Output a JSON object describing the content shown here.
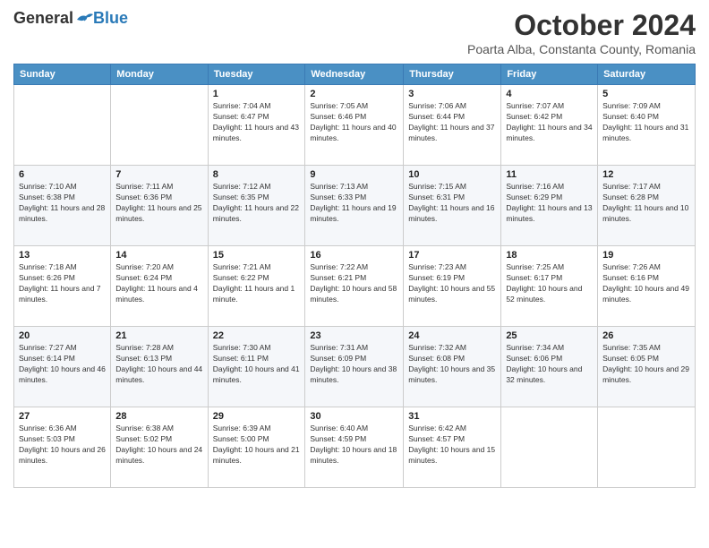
{
  "logo": {
    "general": "General",
    "blue": "Blue"
  },
  "header": {
    "month": "October 2024",
    "location": "Poarta Alba, Constanta County, Romania"
  },
  "weekdays": [
    "Sunday",
    "Monday",
    "Tuesday",
    "Wednesday",
    "Thursday",
    "Friday",
    "Saturday"
  ],
  "weeks": [
    [
      {
        "day": "",
        "sunrise": "",
        "sunset": "",
        "daylight": ""
      },
      {
        "day": "",
        "sunrise": "",
        "sunset": "",
        "daylight": ""
      },
      {
        "day": "1",
        "sunrise": "Sunrise: 7:04 AM",
        "sunset": "Sunset: 6:47 PM",
        "daylight": "Daylight: 11 hours and 43 minutes."
      },
      {
        "day": "2",
        "sunrise": "Sunrise: 7:05 AM",
        "sunset": "Sunset: 6:46 PM",
        "daylight": "Daylight: 11 hours and 40 minutes."
      },
      {
        "day": "3",
        "sunrise": "Sunrise: 7:06 AM",
        "sunset": "Sunset: 6:44 PM",
        "daylight": "Daylight: 11 hours and 37 minutes."
      },
      {
        "day": "4",
        "sunrise": "Sunrise: 7:07 AM",
        "sunset": "Sunset: 6:42 PM",
        "daylight": "Daylight: 11 hours and 34 minutes."
      },
      {
        "day": "5",
        "sunrise": "Sunrise: 7:09 AM",
        "sunset": "Sunset: 6:40 PM",
        "daylight": "Daylight: 11 hours and 31 minutes."
      }
    ],
    [
      {
        "day": "6",
        "sunrise": "Sunrise: 7:10 AM",
        "sunset": "Sunset: 6:38 PM",
        "daylight": "Daylight: 11 hours and 28 minutes."
      },
      {
        "day": "7",
        "sunrise": "Sunrise: 7:11 AM",
        "sunset": "Sunset: 6:36 PM",
        "daylight": "Daylight: 11 hours and 25 minutes."
      },
      {
        "day": "8",
        "sunrise": "Sunrise: 7:12 AM",
        "sunset": "Sunset: 6:35 PM",
        "daylight": "Daylight: 11 hours and 22 minutes."
      },
      {
        "day": "9",
        "sunrise": "Sunrise: 7:13 AM",
        "sunset": "Sunset: 6:33 PM",
        "daylight": "Daylight: 11 hours and 19 minutes."
      },
      {
        "day": "10",
        "sunrise": "Sunrise: 7:15 AM",
        "sunset": "Sunset: 6:31 PM",
        "daylight": "Daylight: 11 hours and 16 minutes."
      },
      {
        "day": "11",
        "sunrise": "Sunrise: 7:16 AM",
        "sunset": "Sunset: 6:29 PM",
        "daylight": "Daylight: 11 hours and 13 minutes."
      },
      {
        "day": "12",
        "sunrise": "Sunrise: 7:17 AM",
        "sunset": "Sunset: 6:28 PM",
        "daylight": "Daylight: 11 hours and 10 minutes."
      }
    ],
    [
      {
        "day": "13",
        "sunrise": "Sunrise: 7:18 AM",
        "sunset": "Sunset: 6:26 PM",
        "daylight": "Daylight: 11 hours and 7 minutes."
      },
      {
        "day": "14",
        "sunrise": "Sunrise: 7:20 AM",
        "sunset": "Sunset: 6:24 PM",
        "daylight": "Daylight: 11 hours and 4 minutes."
      },
      {
        "day": "15",
        "sunrise": "Sunrise: 7:21 AM",
        "sunset": "Sunset: 6:22 PM",
        "daylight": "Daylight: 11 hours and 1 minute."
      },
      {
        "day": "16",
        "sunrise": "Sunrise: 7:22 AM",
        "sunset": "Sunset: 6:21 PM",
        "daylight": "Daylight: 10 hours and 58 minutes."
      },
      {
        "day": "17",
        "sunrise": "Sunrise: 7:23 AM",
        "sunset": "Sunset: 6:19 PM",
        "daylight": "Daylight: 10 hours and 55 minutes."
      },
      {
        "day": "18",
        "sunrise": "Sunrise: 7:25 AM",
        "sunset": "Sunset: 6:17 PM",
        "daylight": "Daylight: 10 hours and 52 minutes."
      },
      {
        "day": "19",
        "sunrise": "Sunrise: 7:26 AM",
        "sunset": "Sunset: 6:16 PM",
        "daylight": "Daylight: 10 hours and 49 minutes."
      }
    ],
    [
      {
        "day": "20",
        "sunrise": "Sunrise: 7:27 AM",
        "sunset": "Sunset: 6:14 PM",
        "daylight": "Daylight: 10 hours and 46 minutes."
      },
      {
        "day": "21",
        "sunrise": "Sunrise: 7:28 AM",
        "sunset": "Sunset: 6:13 PM",
        "daylight": "Daylight: 10 hours and 44 minutes."
      },
      {
        "day": "22",
        "sunrise": "Sunrise: 7:30 AM",
        "sunset": "Sunset: 6:11 PM",
        "daylight": "Daylight: 10 hours and 41 minutes."
      },
      {
        "day": "23",
        "sunrise": "Sunrise: 7:31 AM",
        "sunset": "Sunset: 6:09 PM",
        "daylight": "Daylight: 10 hours and 38 minutes."
      },
      {
        "day": "24",
        "sunrise": "Sunrise: 7:32 AM",
        "sunset": "Sunset: 6:08 PM",
        "daylight": "Daylight: 10 hours and 35 minutes."
      },
      {
        "day": "25",
        "sunrise": "Sunrise: 7:34 AM",
        "sunset": "Sunset: 6:06 PM",
        "daylight": "Daylight: 10 hours and 32 minutes."
      },
      {
        "day": "26",
        "sunrise": "Sunrise: 7:35 AM",
        "sunset": "Sunset: 6:05 PM",
        "daylight": "Daylight: 10 hours and 29 minutes."
      }
    ],
    [
      {
        "day": "27",
        "sunrise": "Sunrise: 6:36 AM",
        "sunset": "Sunset: 5:03 PM",
        "daylight": "Daylight: 10 hours and 26 minutes."
      },
      {
        "day": "28",
        "sunrise": "Sunrise: 6:38 AM",
        "sunset": "Sunset: 5:02 PM",
        "daylight": "Daylight: 10 hours and 24 minutes."
      },
      {
        "day": "29",
        "sunrise": "Sunrise: 6:39 AM",
        "sunset": "Sunset: 5:00 PM",
        "daylight": "Daylight: 10 hours and 21 minutes."
      },
      {
        "day": "30",
        "sunrise": "Sunrise: 6:40 AM",
        "sunset": "Sunset: 4:59 PM",
        "daylight": "Daylight: 10 hours and 18 minutes."
      },
      {
        "day": "31",
        "sunrise": "Sunrise: 6:42 AM",
        "sunset": "Sunset: 4:57 PM",
        "daylight": "Daylight: 10 hours and 15 minutes."
      },
      {
        "day": "",
        "sunrise": "",
        "sunset": "",
        "daylight": ""
      },
      {
        "day": "",
        "sunrise": "",
        "sunset": "",
        "daylight": ""
      }
    ]
  ]
}
